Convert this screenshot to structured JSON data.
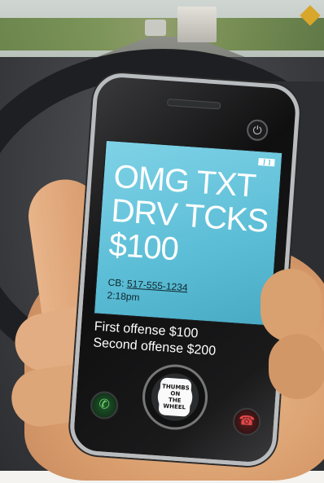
{
  "screen": {
    "headline_line1": "OMG TXT",
    "headline_line2": "DRV TCKS",
    "headline_line3": "$100",
    "cb_label": "CB:",
    "cb_number": "517-555-1234",
    "time": "2:18pm"
  },
  "offenses": {
    "first": "First offense $100",
    "second": "Second offense $200"
  },
  "logo": {
    "line1": "THUMBS",
    "line2": "ON",
    "line3": "THE",
    "line4": "WHEEL"
  },
  "icons": {
    "power": "power-icon",
    "call": "phone-call-icon",
    "hangup": "phone-hangup-icon",
    "battery": "battery-icon"
  },
  "colors": {
    "screen": "#5bbdd6",
    "call": "#6fd66f",
    "hangup": "#e24848"
  }
}
